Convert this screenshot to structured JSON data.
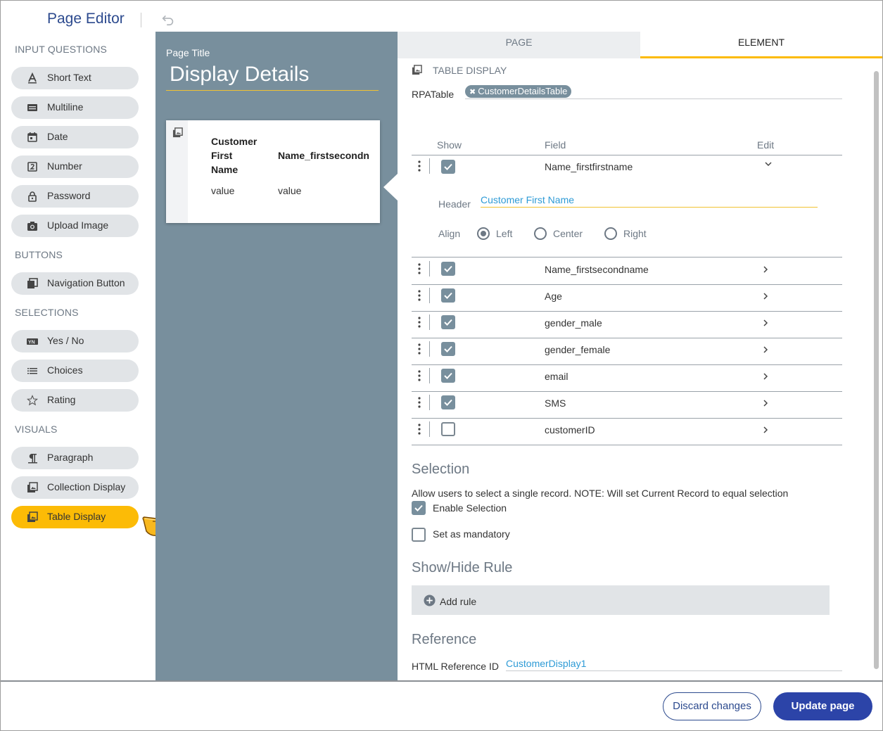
{
  "header": {
    "title": "Page Editor"
  },
  "palette": {
    "sections": [
      "INPUT QUESTIONS",
      "BUTTONS",
      "SELECTIONS",
      "VISUALS"
    ],
    "items": [
      {
        "label": "Short Text",
        "icon": "text-a-icon"
      },
      {
        "label": "Multiline",
        "icon": "multiline-icon"
      },
      {
        "label": "Date",
        "icon": "calendar-icon"
      },
      {
        "label": "Number",
        "icon": "number-icon"
      },
      {
        "label": "Password",
        "icon": "lock-icon"
      },
      {
        "label": "Upload Image",
        "icon": "camera-icon"
      },
      {
        "label": "Navigation Button",
        "icon": "navigation-icon"
      },
      {
        "label": "Yes / No",
        "icon": "yes-no-icon"
      },
      {
        "label": "Choices",
        "icon": "list-icon"
      },
      {
        "label": "Rating",
        "icon": "star-icon"
      },
      {
        "label": "Paragraph",
        "icon": "paragraph-icon"
      },
      {
        "label": "Collection Display",
        "icon": "image-icon"
      },
      {
        "label": "Table Display",
        "icon": "image-icon",
        "active": true
      }
    ],
    "accent_color": "#fcbb06"
  },
  "preview": {
    "page_title_label": "Page Title",
    "page_title": "Display Details",
    "table": {
      "headers": [
        "Customer\nFirst\nName",
        "Name_firstsecondn"
      ],
      "values": [
        "value",
        "value"
      ]
    },
    "background_color": "#788f9d"
  },
  "panel": {
    "tabs": [
      "PAGE",
      "ELEMENT"
    ],
    "element_type": "TABLE DISPLAY",
    "rpa_table_label": "RPATable",
    "rpa_table_value": "CustomerDetailsTable",
    "columns": {
      "show": "Show",
      "field": "Field",
      "edit": "Edit"
    },
    "fields": [
      {
        "name": "Name_firstfirstname",
        "checked": true,
        "expanded": true
      },
      {
        "name": "Name_firstsecondname",
        "checked": true
      },
      {
        "name": "Age",
        "checked": true
      },
      {
        "name": "gender_male",
        "checked": true
      },
      {
        "name": "gender_female",
        "checked": true
      },
      {
        "name": "email",
        "checked": true
      },
      {
        "name": "SMS",
        "checked": true
      },
      {
        "name": "customerID",
        "checked": false
      }
    ],
    "expanded": {
      "header_label": "Header",
      "header_value": "Customer First Name",
      "align_label": "Align",
      "align_options": [
        "Left",
        "Center",
        "Right"
      ],
      "align_selected": "Left"
    },
    "selection": {
      "title": "Selection",
      "description": "Allow users to select a single record. NOTE: Will set Current Record to equal selection",
      "enable_label": "Enable Selection",
      "enable_checked": true,
      "mandatory_label": "Set as mandatory",
      "mandatory_checked": false
    },
    "show_hide": {
      "title": "Show/Hide Rule",
      "add_rule": "Add rule"
    },
    "reference": {
      "title": "Reference",
      "label": "HTML Reference ID",
      "value": "CustomerDisplay1"
    }
  },
  "footer": {
    "discard": "Discard changes",
    "update": "Update page"
  }
}
